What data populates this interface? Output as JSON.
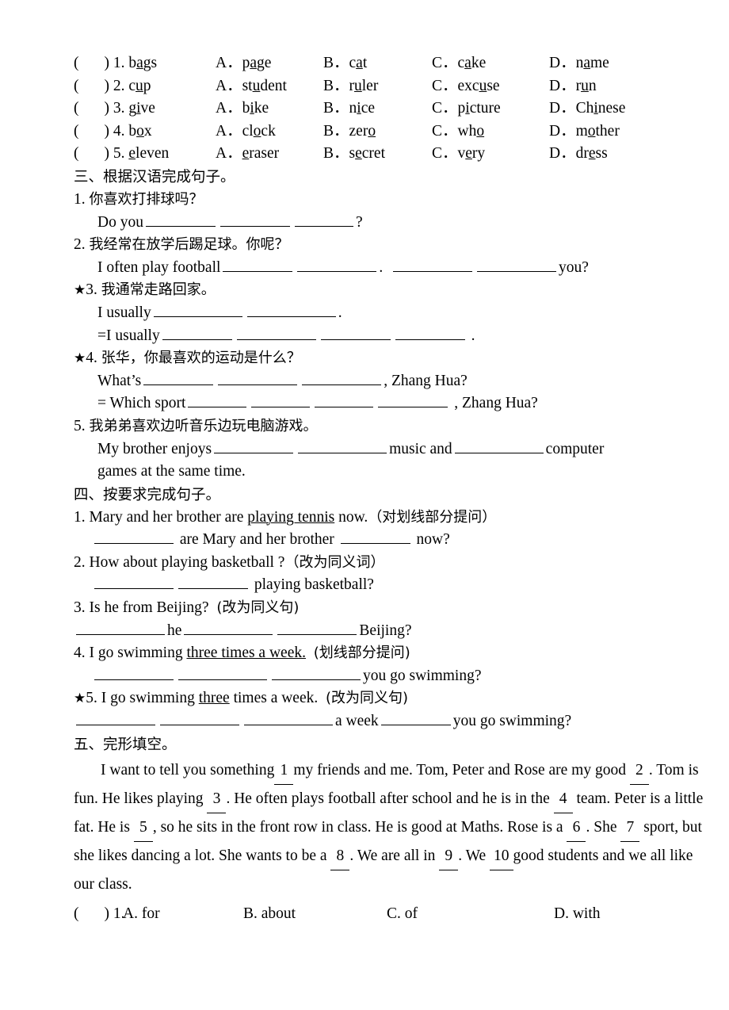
{
  "section_two": {
    "rows": [
      {
        "paren": "(",
        "paren_close": ")",
        "number": "1.",
        "stem_pre": "b",
        "stem_u": "a",
        "stem_post": "gs",
        "a_label": "A．",
        "a_pre": "p",
        "a_u": "a",
        "a_post": "ge",
        "b_label": "B．",
        "b_pre": "c",
        "b_u": "a",
        "b_post": "t",
        "c_label": "C．",
        "c_pre": "c",
        "c_u": "a",
        "c_post": "ke",
        "d_label": "D．",
        "d_pre": "n",
        "d_u": "a",
        "d_post": "me"
      },
      {
        "paren": "(",
        "paren_close": ")",
        "number": "2.",
        "stem_pre": "c",
        "stem_u": "u",
        "stem_post": "p",
        "a_label": "A．",
        "a_pre": "st",
        "a_u": "u",
        "a_post": "dent",
        "b_label": "B．",
        "b_pre": "r",
        "b_u": "u",
        "b_post": "ler",
        "c_label": "C．",
        "c_pre": "exc",
        "c_u": "u",
        "c_post": "se",
        "d_label": "D．",
        "d_pre": "r",
        "d_u": "u",
        "d_post": "n"
      },
      {
        "paren": "(",
        "paren_close": ")",
        "number": "3.",
        "stem_pre": "g",
        "stem_u": "i",
        "stem_post": "ve",
        "a_label": "A．",
        "a_pre": "b",
        "a_u": "i",
        "a_post": "ke",
        "b_label": "B．",
        "b_pre": "n",
        "b_u": "i",
        "b_post": "ce",
        "c_label": "C．",
        "c_pre": "p",
        "c_u": "i",
        "c_post": "cture",
        "d_label": "D．",
        "d_pre": "Ch",
        "d_u": "i",
        "d_post": "nese"
      },
      {
        "paren": "(",
        "paren_close": ")",
        "number": "4.",
        "stem_pre": "b",
        "stem_u": "o",
        "stem_post": "x",
        "a_label": "A．",
        "a_pre": "cl",
        "a_u": "o",
        "a_post": "ck",
        "b_label": "B．",
        "b_pre": "zer",
        "b_u": "o",
        "b_post": "",
        "c_label": "C．",
        "c_pre": "wh",
        "c_u": "o",
        "c_post": "",
        "d_label": "D．",
        "d_pre": "m",
        "d_u": "o",
        "d_post": "ther"
      },
      {
        "paren": "(",
        "paren_close": ")",
        "number": "5.",
        "stem_pre": "",
        "stem_u": "e",
        "stem_post": "leven",
        "a_label": "A．",
        "a_pre": "",
        "a_u": "e",
        "a_post": "raser",
        "b_label": "B．",
        "b_pre": "s",
        "b_u": "e",
        "b_post": "cret",
        "c_label": "C．",
        "c_pre": "v",
        "c_u": "e",
        "c_post": "ry",
        "d_label": "D．",
        "d_pre": "dr",
        "d_u": "e",
        "d_post": "ss"
      }
    ]
  },
  "section_three": {
    "heading": "三、根据汉语完成句子。",
    "q1": {
      "number": "1.",
      "chinese": "你喜欢打排球吗？",
      "answer_pre": "Do you",
      "answer_post": "?"
    },
    "q2": {
      "number": "2.",
      "chinese": "我经常在放学后踢足球。你呢？",
      "answer_pre": "I often play football",
      "answer_mid": ".",
      "answer_post": "you?"
    },
    "q3": {
      "star": "★",
      "number": "3.",
      "chinese": "我通常走路回家。",
      "line1_pre": "I usually",
      "line1_post": ".",
      "line2_pre": "=I usually",
      "line2_post": "."
    },
    "q4": {
      "star": "★",
      "number": "4.",
      "chinese": "张华，你最喜欢的运动是什么？",
      "line1_pre": "What’s",
      "line1_post": ", Zhang Hua?",
      "line2_pre": "= Which sport",
      "line2_post": ", Zhang Hua?"
    },
    "q5": {
      "number": "5.",
      "chinese": "我弟弟喜欢边听音乐边玩电脑游戏。",
      "line1_pre": "My  brother  enjoys",
      "line1_mid": "music  and",
      "line1_post": "computer",
      "line2": "games at the same time."
    }
  },
  "section_four": {
    "heading": "四、按要求完成句子。",
    "q1": {
      "number": "1.",
      "text_pre": "Mary and her brother are ",
      "text_ul": "playing tennis",
      "text_post": " now.",
      "instruction": "（对划线部分提问）",
      "ans_mid": "are Mary and her brother",
      "ans_post": "now?"
    },
    "q2": {
      "number": "2.",
      "text": "How about playing basketball ?",
      "instruction": "（改为同义词）",
      "ans_post": "playing basketball?"
    },
    "q3": {
      "number": "3.",
      "text": "Is he from Beijing?",
      "instruction": "(改为同义句)",
      "ans_mid": "he",
      "ans_post": "Beijing?"
    },
    "q4": {
      "number": "4.",
      "text_pre": "I go swimming ",
      "text_ul": "three times a week.",
      "instruction": "(划线部分提问)",
      "ans_post": "you go swimming?"
    },
    "q5": {
      "star": "★",
      "number": "5.",
      "text_pre": "I go swimming ",
      "text_ul": "three",
      "text_post": " times a week.",
      "instruction": "(改为同义句)",
      "ans_mid": "a week",
      "ans_post": "you go swimming?"
    }
  },
  "section_five": {
    "heading": "五、完形填空。",
    "passage": {
      "p1": "I want to tell you something",
      "b1": "1",
      "p2": "my friends and me. Tom, Peter and Rose are my good",
      "b2": "2",
      "p3": ". Tom is fun. He likes playing",
      "b3": "3",
      "p4": ". He often plays football after school and he is in the",
      "b4": "4",
      "p5": "team. Peter is a little fat. He is",
      "b5": "5",
      "p6": ", so he sits in the front row in class. He is good at Maths. Rose is a",
      "b6": "6",
      "p7": ". She",
      "b7": "7",
      "p8": "sport, but she likes dancing a lot. She wants to be a",
      "b8": "8",
      "p9": ". We are all in",
      "b9": "9",
      "p10": ". We",
      "b10": "10",
      "p11": "good students and we all like our class."
    },
    "mc": [
      {
        "paren": "(",
        "paren_close": ")",
        "number": "1.",
        "a": "A. for",
        "b": "B. about",
        "c": "C. of",
        "d": "D. with"
      }
    ]
  }
}
